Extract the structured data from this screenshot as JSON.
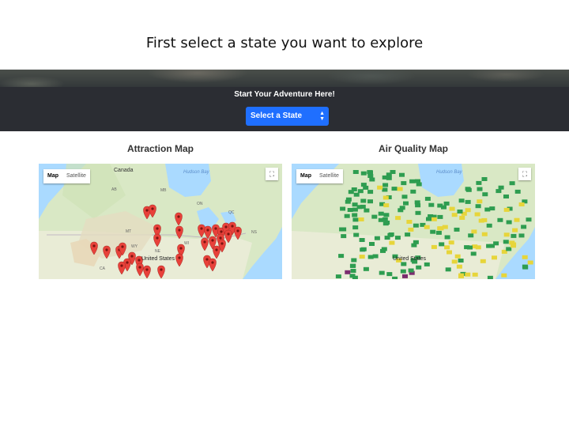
{
  "caption": "First select a state you want to explore",
  "hero": {
    "title": "Start Your Adventure Here!"
  },
  "state_select": {
    "value": "Select a State"
  },
  "attraction_map": {
    "title": "Attraction Map",
    "toggle": {
      "map": "Map",
      "satellite": "Satellite"
    },
    "labels": {
      "canada": "Canada",
      "hudson_bay": "Hudson Bay",
      "united_states": "United States",
      "ab": "AB",
      "mb": "MB",
      "on": "ON",
      "qc": "QC",
      "mt": "MT",
      "wy": "WY",
      "ne": "NE",
      "ns": "NS",
      "ca": "CA",
      "wi": "WI"
    }
  },
  "air_quality_map": {
    "title": "Air Quality Map",
    "toggle": {
      "map": "Map",
      "satellite": "Satellite"
    },
    "labels": {
      "hudson_bay": "Hudson Bay",
      "united_states": "United States"
    }
  },
  "icons": {
    "fullscreen": "fullscreen-icon",
    "select_arrows": "updown-arrow-icon",
    "marker": "map-marker-icon"
  },
  "colors": {
    "select_bg": "#1f6fff",
    "marker": "#e8413a",
    "aq_good": "#2e9d50",
    "aq_moderate": "#e7d53a",
    "water": "#aadaff"
  }
}
